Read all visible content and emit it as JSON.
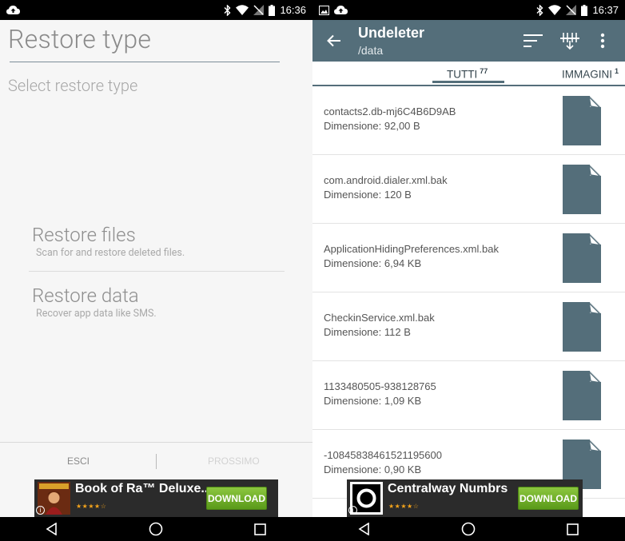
{
  "left": {
    "status": {
      "time": "16:36"
    },
    "title": "Restore type",
    "subtitle": "Select restore type",
    "options": [
      {
        "title": "Restore files",
        "desc": "Scan for and restore deleted files."
      },
      {
        "title": "Restore data",
        "desc": "Recover app data like SMS."
      }
    ],
    "footer": {
      "exit": "ESCI",
      "next": "PROSSIMO"
    },
    "ad": {
      "title": "Book of Ra™ Deluxe...",
      "stars": "★★★★☆",
      "button": "DOWNLOAD",
      "info": "i"
    }
  },
  "right": {
    "status": {
      "time": "16:37"
    },
    "toolbar": {
      "title": "Undeleter",
      "path": "/data"
    },
    "tabs": [
      {
        "label": "TUTTI",
        "count": "77"
      },
      {
        "label": "IMMAGINI",
        "count": "1"
      }
    ],
    "files": [
      {
        "name": "contacts2.db-mj6C4B6D9AB",
        "size": "Dimensione: 92,00 B"
      },
      {
        "name": "com.android.dialer.xml.bak",
        "size": "Dimensione: 120 B"
      },
      {
        "name": "ApplicationHidingPreferences.xml.bak",
        "size": "Dimensione: 6,94 KB"
      },
      {
        "name": "CheckinService.xml.bak",
        "size": "Dimensione: 112 B"
      },
      {
        "name": "1133480505-938128765",
        "size": "Dimensione: 1,09 KB"
      },
      {
        "name": "-10845838461521195600",
        "size": "Dimensione: 0,90 KB"
      }
    ],
    "ad": {
      "title": "Centralway Numbrs",
      "stars": "★★★★☆",
      "button": "DOWNLOAD",
      "info": "i"
    }
  },
  "colors": {
    "toolbar": "#546e7a",
    "file_icon": "#546e7a",
    "download": "#6fb22c"
  }
}
